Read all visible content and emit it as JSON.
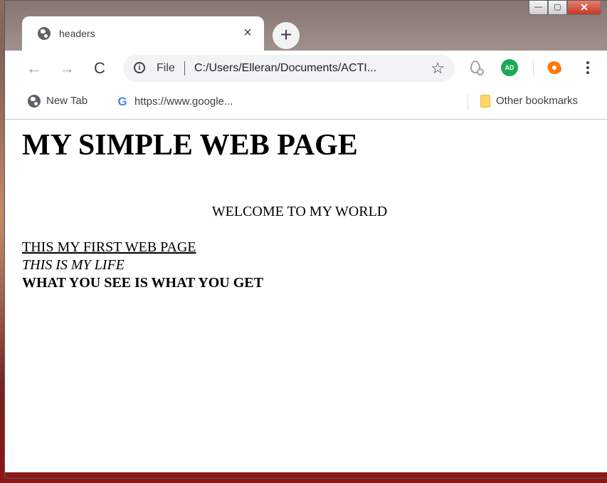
{
  "browser": {
    "tab": {
      "title": "headers",
      "favicon": "globe-icon",
      "close_glyph": "×"
    },
    "new_tab_glyph": "+",
    "window_controls": {
      "minimize": "—",
      "maximize": "▢",
      "close": "✕"
    },
    "nav": {
      "back": "←",
      "forward": "→",
      "reload": "C"
    },
    "omnibox": {
      "info_glyph": "i",
      "scheme": "File",
      "url": "C:/Users/Elleran/Documents/ACTI..."
    },
    "star_glyph": "☆",
    "extensions": [
      {
        "name": "ink-extension-icon"
      },
      {
        "name": "adblock-icon",
        "label": "AD",
        "color": "#1aaa55"
      },
      {
        "name": "avast-icon",
        "color": "#ff7800"
      }
    ],
    "bookmarks": [
      {
        "label": "New Tab",
        "icon": "globe-icon"
      },
      {
        "label": "https://www.google...",
        "icon": "google-icon"
      }
    ],
    "google_glyph": "G",
    "other_bookmarks": "Other bookmarks"
  },
  "page": {
    "heading": "MY SIMPLE WEB PAGE",
    "welcome": "WELCOME TO MY WORLD",
    "line_underline": "THIS MY FIRST WEB PAGE",
    "line_italic": "THIS IS MY LIFE",
    "line_bold": "WHAT YOU SEE IS WHAT YOU GET"
  }
}
